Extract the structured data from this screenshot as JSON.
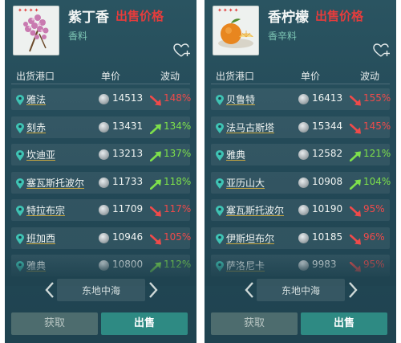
{
  "panels": [
    {
      "id": "clove",
      "item_name": "紫丁香",
      "sell_price_label": "出售价格",
      "category": "香料",
      "columns": {
        "port": "出货港口",
        "unit_price": "单价",
        "change": "波动"
      },
      "rows": [
        {
          "port": "雅法",
          "price": "14513",
          "trend": "down",
          "change": "148%"
        },
        {
          "port": "刻赤",
          "price": "13431",
          "trend": "up",
          "change": "134%"
        },
        {
          "port": "坎迪亚",
          "price": "13213",
          "trend": "up",
          "change": "137%"
        },
        {
          "port": "塞瓦斯托波尔",
          "price": "11733",
          "trend": "up",
          "change": "118%"
        },
        {
          "port": "特拉布宗",
          "price": "11709",
          "trend": "down",
          "change": "117%"
        },
        {
          "port": "班加西",
          "price": "10946",
          "trend": "down",
          "change": "105%"
        },
        {
          "port": "雅典",
          "price": "10800",
          "trend": "up",
          "change": "112%"
        }
      ],
      "region": "东地中海",
      "btn_get": "获取",
      "btn_sell": "出售"
    },
    {
      "id": "lemon",
      "item_name": "香柠檬",
      "sell_price_label": "出售价格",
      "category": "香辛料",
      "columns": {
        "port": "出货港口",
        "unit_price": "单价",
        "change": "波动"
      },
      "rows": [
        {
          "port": "贝鲁特",
          "price": "16413",
          "trend": "down",
          "change": "155%"
        },
        {
          "port": "法马古斯塔",
          "price": "15344",
          "trend": "down",
          "change": "145%"
        },
        {
          "port": "雅典",
          "price": "12582",
          "trend": "up",
          "change": "121%"
        },
        {
          "port": "亚历山大",
          "price": "10908",
          "trend": "up",
          "change": "104%"
        },
        {
          "port": "塞瓦斯托波尔",
          "price": "10190",
          "trend": "down",
          "change": "95%"
        },
        {
          "port": "伊斯坦布尔",
          "price": "10185",
          "trend": "down",
          "change": "96%"
        },
        {
          "port": "萨洛尼卡",
          "price": "9983",
          "trend": "down",
          "change": "95%"
        }
      ],
      "region": "东地中海",
      "btn_get": "获取",
      "btn_sell": "出售"
    }
  ],
  "colors": {
    "up": "#7ee04b",
    "down": "#f04a4a",
    "sell_price": "#e53c3c",
    "category": "#7dc6b4"
  },
  "icons": {
    "stars": "red-stars",
    "location": "map-pin-icon",
    "coin": "silver-coin-icon",
    "favorite": "heart-plus-icon"
  }
}
